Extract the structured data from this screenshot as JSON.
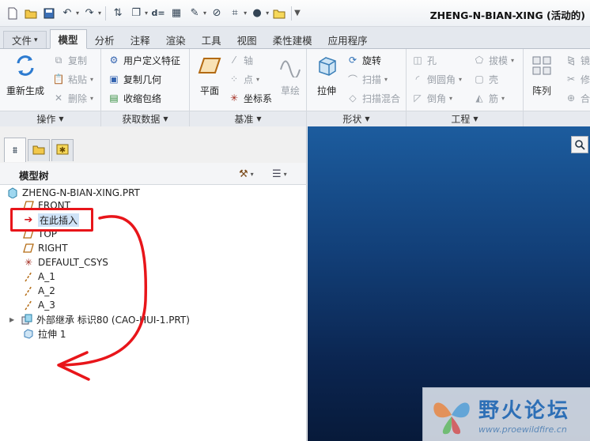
{
  "window": {
    "title": "ZHENG-N-BIAN-XING (活动的)"
  },
  "quick_access": {
    "icons": [
      "new-icon",
      "open-icon",
      "save-icon",
      "undo-icon",
      "redo-icon",
      "regenerate-icon",
      "window-icon",
      "dimension-icon",
      "measure-icon",
      "ruler-icon",
      "no-icon",
      "datum-display-icon",
      "appearance-icon",
      "folder-icon",
      "more-icon"
    ]
  },
  "tabs": [
    {
      "label": "文件",
      "dropdown": "▾"
    },
    {
      "label": "模型"
    },
    {
      "label": "分析"
    },
    {
      "label": "注释"
    },
    {
      "label": "渲染"
    },
    {
      "label": "工具"
    },
    {
      "label": "视图"
    },
    {
      "label": "柔性建模"
    },
    {
      "label": "应用程序"
    }
  ],
  "ribbon": {
    "operations": {
      "regenerate": "重新生成",
      "copy": "复制",
      "paste": "粘贴",
      "delete": "删除",
      "group_label": "操作"
    },
    "get_data": {
      "udf": "用户定义特征",
      "copy_geom": "复制几何",
      "shrinkwrap": "收缩包络",
      "group_label": "获取数据"
    },
    "datum": {
      "plane": "平面",
      "axis": "轴",
      "point": "点",
      "csys": "坐标系",
      "sketch": "草绘",
      "group_label": "基准"
    },
    "shapes": {
      "extrude": "拉伸",
      "revolve": "旋转",
      "sweep": "扫描",
      "swept_blend": "扫描混合",
      "group_label": "形状"
    },
    "engineering": {
      "hole": "孔",
      "round": "倒圆角",
      "chamfer": "倒角",
      "draft": "拔模",
      "shell": "壳",
      "rib": "筋",
      "group_label": "工程"
    },
    "editing": {
      "pattern": "阵列",
      "mirror": "镜",
      "trim": "修",
      "merge": "合"
    }
  },
  "model_tree": {
    "header": "模型树",
    "items": [
      {
        "label": "ZHENG-N-BIAN-XING.PRT",
        "icon": "part-icon"
      },
      {
        "label": "FRONT",
        "icon": "datum-plane-icon"
      },
      {
        "label": "在此插入",
        "icon": "insert-arrow-icon"
      },
      {
        "label": "TOP",
        "icon": "datum-plane-icon"
      },
      {
        "label": "RIGHT",
        "icon": "datum-plane-icon"
      },
      {
        "label": "DEFAULT_CSYS",
        "icon": "csys-icon"
      },
      {
        "label": "A_1",
        "icon": "axis-icon"
      },
      {
        "label": "A_2",
        "icon": "axis-icon"
      },
      {
        "label": "A_3",
        "icon": "axis-icon"
      },
      {
        "label": "外部继承 标识80 (CAO-HUI-1.PRT)",
        "icon": "external-inheritance-icon"
      },
      {
        "label": "拉伸 1",
        "icon": "extrude-feature-icon"
      }
    ]
  },
  "watermark": {
    "text": "野火论坛",
    "url": "www.proewildfire.cn"
  },
  "colors": {
    "annotation_red": "#e8151a",
    "viewport_top": "#1c5c9e",
    "viewport_bottom": "#071a3a"
  }
}
